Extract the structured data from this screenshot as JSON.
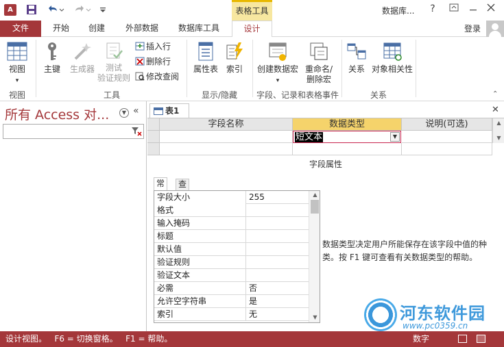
{
  "app": {
    "icon_text": "A",
    "context_tab_group": "表格工具",
    "window_title": "数据库...",
    "help_glyph": "?",
    "login": "登录"
  },
  "tabs": [
    {
      "label": "文件"
    },
    {
      "label": "开始"
    },
    {
      "label": "创建"
    },
    {
      "label": "外部数据"
    },
    {
      "label": "数据库工具"
    },
    {
      "label": "设计"
    }
  ],
  "ribbon": {
    "view": {
      "label": "视图",
      "group": "视图"
    },
    "tools": {
      "group": "工具",
      "primary_key": "主键",
      "builder": "生成器",
      "test_rules_1": "测试",
      "test_rules_2": "验证规则",
      "insert_row": "插入行",
      "delete_row": "删除行",
      "modify_lookup": "修改查阅"
    },
    "showhide": {
      "group": "显示/隐藏",
      "property_sheet": "属性表",
      "indexes": "索引"
    },
    "events": {
      "group": "字段、记录和表格事件",
      "create_macro": "创建数据宏",
      "rename_1": "重命名/",
      "rename_2": "删除宏"
    },
    "relationships": {
      "group": "关系",
      "relationships": "关系",
      "object_deps": "对象相关性"
    }
  },
  "nav": {
    "title": "所有 Access 对...",
    "search_placeholder": ""
  },
  "doc": {
    "tab_label": "表1",
    "columns": [
      "字段名称",
      "数据类型",
      "说明(可选)"
    ],
    "rows": [
      {
        "field_name": "",
        "data_type": "短文本",
        "description": ""
      },
      {
        "field_name": "",
        "data_type": "",
        "description": ""
      }
    ],
    "props_title": "字段属性",
    "prop_tabs": [
      "常规",
      "查阅"
    ],
    "properties": [
      {
        "name": "字段大小",
        "value": "255"
      },
      {
        "name": "格式",
        "value": ""
      },
      {
        "name": "输入掩码",
        "value": ""
      },
      {
        "name": "标题",
        "value": ""
      },
      {
        "name": "默认值",
        "value": ""
      },
      {
        "name": "验证规则",
        "value": ""
      },
      {
        "name": "验证文本",
        "value": ""
      },
      {
        "name": "必需",
        "value": "否"
      },
      {
        "name": "允许空字符串",
        "value": "是"
      },
      {
        "name": "索引",
        "value": "无"
      }
    ],
    "help_text": "数据类型决定用户所能保存在该字段中值的种类。按 F1 键可查看有关数据类型的帮助。"
  },
  "status": {
    "text": "设计视图。   F6 = 切换窗格。   F1 = 帮助。",
    "numlock": "数字"
  },
  "watermark": {
    "title": "河东软件园",
    "url": "www.pc0359.cn"
  },
  "colors": {
    "accent": "#a4373a",
    "context": "#f7e7a0",
    "selected_header": "#f5d36b"
  }
}
